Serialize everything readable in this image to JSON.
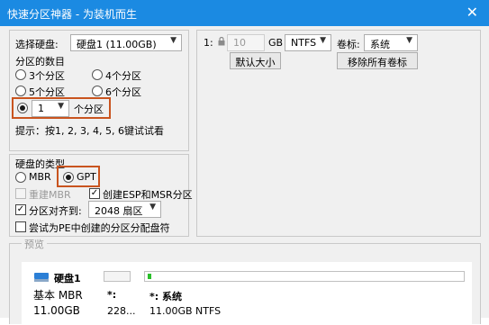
{
  "window": {
    "title": "快速分区神器 - 为装机而生",
    "close_glyph": "✕"
  },
  "disk_select": {
    "label": "选择硬盘:",
    "value": "硬盘1 (11.00GB)"
  },
  "partition_count": {
    "label": "分区的数目",
    "options": [
      "3个分区",
      "4个分区",
      "5个分区",
      "6个分区"
    ],
    "custom_value": "1",
    "custom_suffix": "个分区",
    "hint": "提示：按1, 2, 3, 4, 5, 6键试试看"
  },
  "disk_type": {
    "label": "硬盘的类型",
    "mbr": "MBR",
    "gpt": "GPT",
    "rebuild_mbr": "重建MBR",
    "create_esp_msr": "创建ESP和MSR分区",
    "align_label": "分区对齐到:",
    "align_value": "2048 扇区",
    "pe_assign": "尝试为PE中创建的分区分配盘符"
  },
  "partition_row": {
    "index": "1:",
    "size": "10",
    "unit": "GB",
    "fs": "NTFS",
    "volume_label": "卷标:",
    "volume_value": "系统",
    "default_size_button": "默认大小",
    "remove_labels_button": "移除所有卷标"
  },
  "preview": {
    "label": "预览",
    "disk_name": "硬盘1",
    "disk_type": "基本 MBR",
    "disk_size": "11.00GB",
    "p1_letter": "*:",
    "p1_size": "228...",
    "p2_letter": "*: 系统",
    "p2_info": "11.00GB NTFS"
  },
  "colors": {
    "titlebar": "#1b8ae2",
    "highlight": "#c9541f",
    "partition_bar": "#2bbf2b"
  }
}
